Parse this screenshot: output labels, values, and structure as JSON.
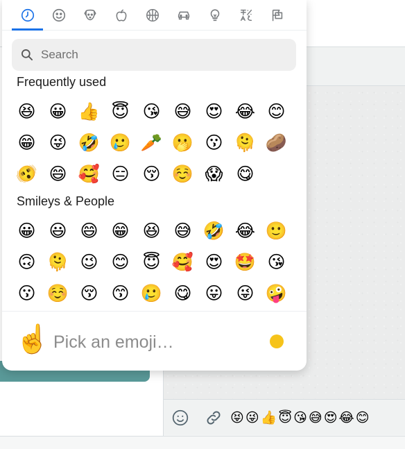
{
  "picker": {
    "tabs": [
      {
        "icon": "clock-icon",
        "active": true
      },
      {
        "icon": "smiley-icon",
        "active": false
      },
      {
        "icon": "dog-icon",
        "active": false
      },
      {
        "icon": "apple-icon",
        "active": false
      },
      {
        "icon": "basketball-icon",
        "active": false
      },
      {
        "icon": "car-icon",
        "active": false
      },
      {
        "icon": "lightbulb-icon",
        "active": false
      },
      {
        "icon": "symbols-icon",
        "active": false
      },
      {
        "icon": "flags-icon",
        "active": false
      }
    ],
    "search": {
      "placeholder": "Search"
    },
    "sections": [
      {
        "title": "Frequently used",
        "emojis": [
          "😆",
          "😀",
          "👍",
          "😇",
          "😘",
          "😅",
          "😍",
          "😂",
          "😊",
          "😁",
          "😜",
          "🤣",
          "🥲",
          "🥕",
          "🫢",
          "😗",
          "🫠",
          "🥔",
          "🫨",
          "😄",
          "🥰",
          "😑",
          "😚",
          "☺️",
          "😱",
          "😋"
        ]
      },
      {
        "title": "Smileys & People",
        "emojis": [
          "😀",
          "😃",
          "😄",
          "😁",
          "😆",
          "😅",
          "🤣",
          "😂",
          "🙂",
          "🙃",
          "🫠",
          "😉",
          "😊",
          "😇",
          "🥰",
          "😍",
          "🤩",
          "😘",
          "😗",
          "☺️",
          "😚",
          "😙",
          "🥲",
          "😋",
          "😛",
          "😜",
          "🤪"
        ]
      }
    ],
    "preview": {
      "emoji": "☝️",
      "text": "Pick an emoji…"
    },
    "skin_tone_color": "#f6c31a",
    "accent_color": "#1b72e8"
  },
  "composer": {
    "quick_emojis": [
      "😝",
      "😜",
      "👍",
      "😇",
      "😘",
      "😅",
      "😍",
      "😂",
      "😊"
    ]
  }
}
